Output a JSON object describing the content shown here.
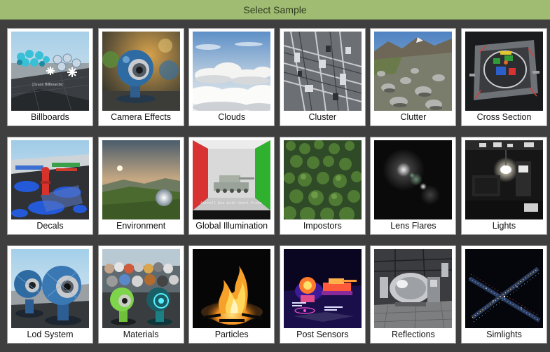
{
  "window": {
    "title": "Select Sample"
  },
  "samples": [
    {
      "label": "Billboards",
      "thumb_text": "[Grass Billboards]"
    },
    {
      "label": "Camera Effects"
    },
    {
      "label": "Clouds"
    },
    {
      "label": "Cluster"
    },
    {
      "label": "Clutter"
    },
    {
      "label": "Cross Section"
    },
    {
      "label": "Decals"
    },
    {
      "label": "Environment"
    },
    {
      "label": "Global Illumination",
      "thumb_text": "Cornell Box With Voxel Probe"
    },
    {
      "label": "Impostors"
    },
    {
      "label": "Lens Flares"
    },
    {
      "label": "Lights"
    },
    {
      "label": "Lod System"
    },
    {
      "label": "Materials"
    },
    {
      "label": "Particles"
    },
    {
      "label": "Post Sensors"
    },
    {
      "label": "Reflections"
    },
    {
      "label": "Simlights"
    }
  ]
}
